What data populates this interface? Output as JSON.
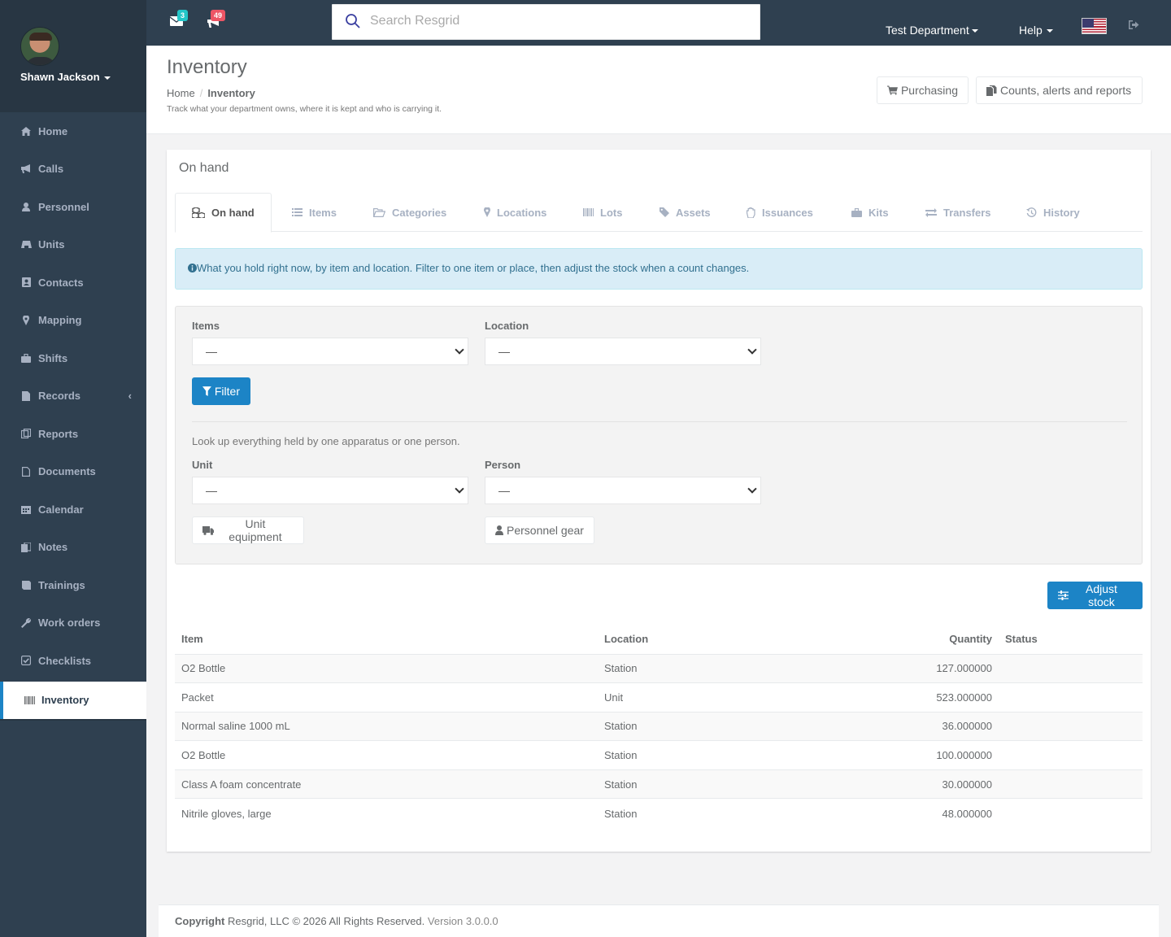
{
  "user": {
    "name": "Shawn Jackson"
  },
  "sidebar": {
    "items": [
      {
        "label": "Home",
        "icon": "home-icon"
      },
      {
        "label": "Calls",
        "icon": "bullhorn-icon"
      },
      {
        "label": "Personnel",
        "icon": "user-icon"
      },
      {
        "label": "Units",
        "icon": "truck-icon"
      },
      {
        "label": "Contacts",
        "icon": "address-book-icon"
      },
      {
        "label": "Mapping",
        "icon": "map-marker-icon"
      },
      {
        "label": "Shifts",
        "icon": "briefcase-icon"
      },
      {
        "label": "Records",
        "icon": "file-icon"
      },
      {
        "label": "Reports",
        "icon": "reports-icon"
      },
      {
        "label": "Documents",
        "icon": "document-icon"
      },
      {
        "label": "Calendar",
        "icon": "calendar-icon"
      },
      {
        "label": "Notes",
        "icon": "notes-icon"
      },
      {
        "label": "Trainings",
        "icon": "book-icon"
      },
      {
        "label": "Work orders",
        "icon": "wrench-icon"
      },
      {
        "label": "Checklists",
        "icon": "check-square-icon"
      },
      {
        "label": "Inventory",
        "icon": "barcode-icon"
      }
    ]
  },
  "topbar": {
    "mail_count": "3",
    "alerts_count": "49",
    "search_placeholder": "Search Resgrid",
    "department": "Test Department",
    "help": "Help",
    "accent_mail": "#23c6c8",
    "accent_alerts": "#ed5565"
  },
  "heading": {
    "title": "Inventory",
    "breadcrumb_home": "Home",
    "breadcrumb_current": "Inventory",
    "subtitle": "Track what your department owns, where it is kept and who is carrying it.",
    "btn_purchasing": "Purchasing",
    "btn_counts": "Counts, alerts and reports"
  },
  "panel": {
    "title": "On hand",
    "tabs": [
      {
        "label": "On hand",
        "icon": "cubes-icon"
      },
      {
        "label": "Items",
        "icon": "list-icon"
      },
      {
        "label": "Categories",
        "icon": "folder-open-icon"
      },
      {
        "label": "Locations",
        "icon": "map-marker-icon"
      },
      {
        "label": "Lots",
        "icon": "barcode-icon"
      },
      {
        "label": "Assets",
        "icon": "tag-icon"
      },
      {
        "label": "Issuances",
        "icon": "hand-icon"
      },
      {
        "label": "Kits",
        "icon": "briefcase-icon"
      },
      {
        "label": "Transfers",
        "icon": "exchange-icon"
      },
      {
        "label": "History",
        "icon": "history-icon"
      }
    ],
    "info": "What you hold right now, by item and location. Filter to one item or place, then adjust the stock when a count changes.",
    "filters": {
      "items_label": "Items",
      "items_value": "—",
      "location_label": "Location",
      "location_value": "—",
      "filter_button": "Filter",
      "lookup_note": "Look up everything held by one apparatus or one person.",
      "unit_label": "Unit",
      "unit_value": "—",
      "person_label": "Person",
      "person_value": "—",
      "unit_button": "Unit equipment",
      "person_button": "Personnel gear"
    },
    "adjust_button": "Adjust stock",
    "table": {
      "headers": [
        "Item",
        "Location",
        "Quantity",
        "Status"
      ],
      "rows": [
        {
          "item": "O2 Bottle",
          "location": "Station",
          "quantity": "127.000000",
          "status": ""
        },
        {
          "item": "Packet",
          "location": "Unit",
          "quantity": "523.000000",
          "status": ""
        },
        {
          "item": "Normal saline 1000 mL",
          "location": "Station",
          "quantity": "36.000000",
          "status": ""
        },
        {
          "item": "O2 Bottle",
          "location": "Station",
          "quantity": "100.000000",
          "status": ""
        },
        {
          "item": "Class A foam concentrate",
          "location": "Station",
          "quantity": "30.000000",
          "status": ""
        },
        {
          "item": "Nitrile gloves, large",
          "location": "Station",
          "quantity": "48.000000",
          "status": ""
        }
      ]
    }
  },
  "footer": {
    "copyright_label": "Copyright",
    "copyright_text": "Resgrid, LLC © 2026 All Rights Reserved.",
    "version": "Version 3.0.0.0"
  }
}
